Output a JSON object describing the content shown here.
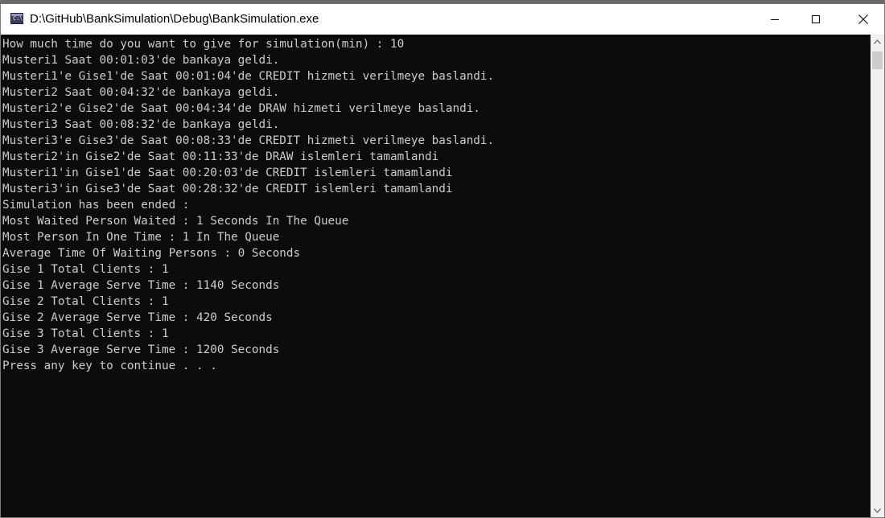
{
  "window": {
    "title": "D:\\GitHub\\BankSimulation\\Debug\\BankSimulation.exe",
    "icon": "console-app-icon",
    "icon_glyph": "C:\\",
    "controls": {
      "minimize_icon": "minimize-icon",
      "maximize_icon": "maximize-icon",
      "close_icon": "close-icon"
    }
  },
  "console": {
    "background_color": "#0c0c0c",
    "text_color": "#cccccc",
    "lines": [
      "How much time do you want to give for simulation(min) : 10",
      "Musteri1 Saat 00:01:03'de bankaya geldi.",
      "Musteri1'e Gise1'de Saat 00:01:04'de CREDIT hizmeti verilmeye baslandi.",
      "Musteri2 Saat 00:04:32'de bankaya geldi.",
      "Musteri2'e Gise2'de Saat 00:04:34'de DRAW hizmeti verilmeye baslandi.",
      "Musteri3 Saat 00:08:32'de bankaya geldi.",
      "Musteri3'e Gise3'de Saat 00:08:33'de CREDIT hizmeti verilmeye baslandi.",
      "Musteri2'in Gise2'de Saat 00:11:33'de DRAW islemleri tamamlandi",
      "Musteri1'in Gise1'de Saat 00:20:03'de CREDIT islemleri tamamlandi",
      "Musteri3'in Gise3'de Saat 00:28:32'de CREDIT islemleri tamamlandi",
      "Simulation has been ended :",
      "Most Waited Person Waited : 1 Seconds In The Queue",
      "Most Person In One Time : 1 In The Queue",
      "Average Time Of Waiting Persons : 0 Seconds",
      "Gise 1 Total Clients : 1",
      "Gise 1 Average Serve Time : 1140 Seconds",
      "Gise 2 Total Clients : 1",
      "Gise 2 Average Serve Time : 420 Seconds",
      "Gise 3 Total Clients : 1",
      "Gise 3 Average Serve Time : 1200 Seconds",
      "Press any key to continue . . ."
    ]
  },
  "scrollbar": {
    "up_icon": "scroll-up-arrow-icon",
    "down_icon": "scroll-down-arrow-icon",
    "position": 0
  }
}
